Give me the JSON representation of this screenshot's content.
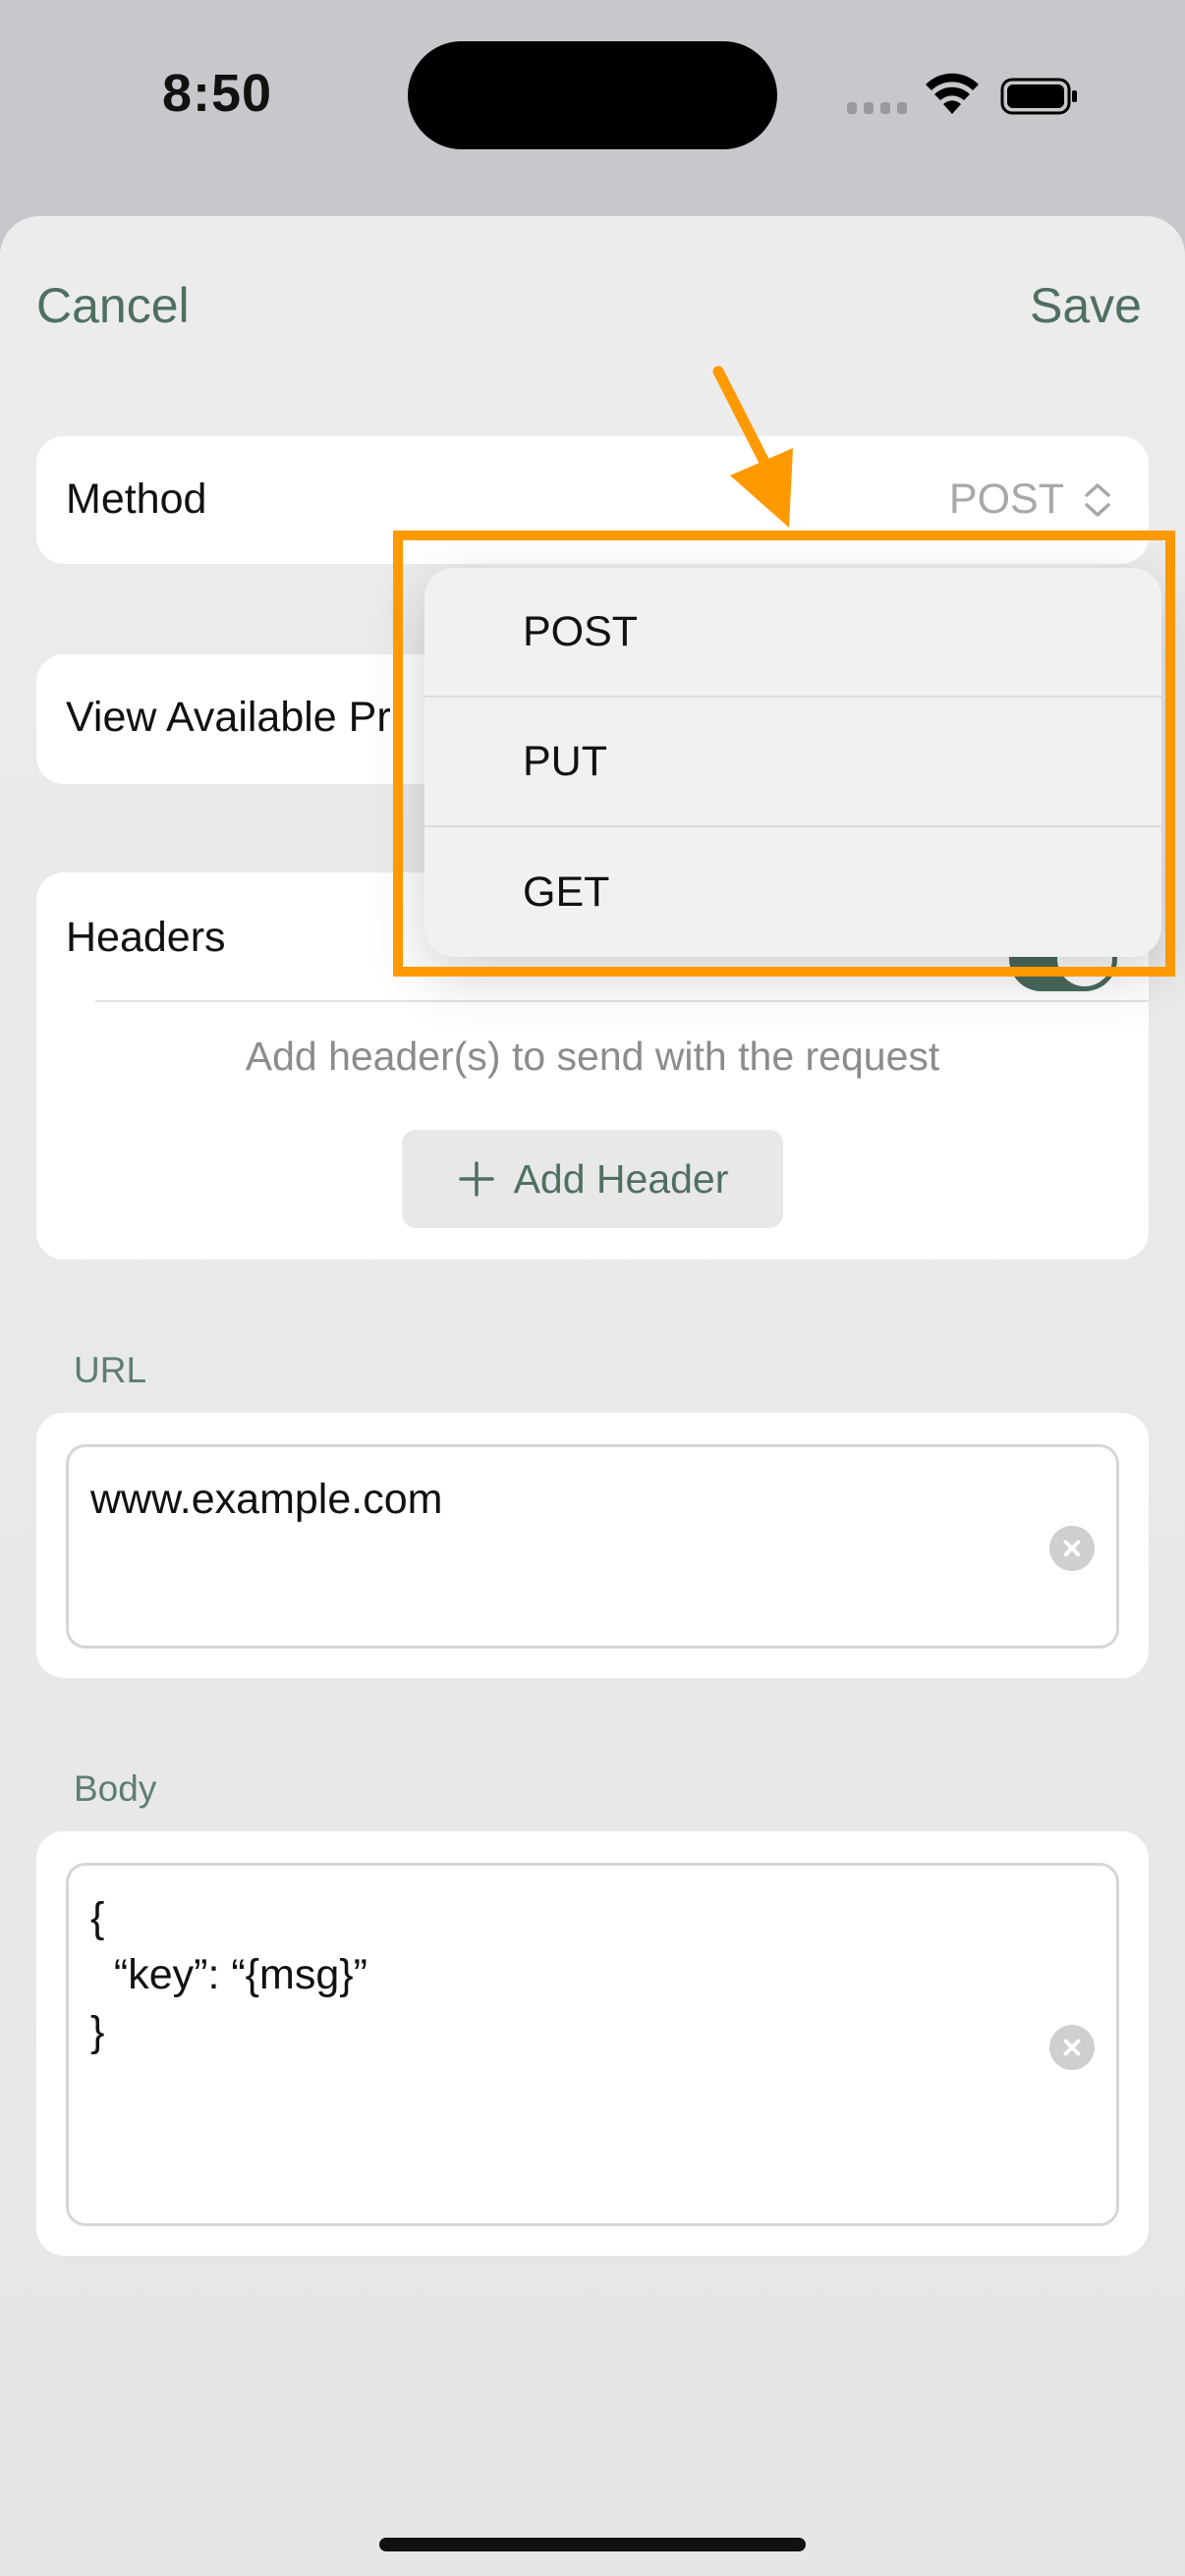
{
  "status_bar": {
    "time": "8:50",
    "icons": [
      "cellular-signal-icon",
      "wifi-icon",
      "battery-icon"
    ]
  },
  "nav": {
    "cancel_label": "Cancel",
    "save_label": "Save"
  },
  "method": {
    "label": "Method",
    "value": "POST",
    "icon": "chevron-updown-icon"
  },
  "available": {
    "label": "View Available Pr"
  },
  "headers": {
    "label": "Headers",
    "toggle_on": true,
    "hint": "Add header(s) to send with the request",
    "add_button": "Add Header",
    "add_icon": "plus-icon"
  },
  "url": {
    "section_label": "URL",
    "value": "www.example.com"
  },
  "body": {
    "section_label": "Body",
    "value": "{\n  “key”: “{msg}”\n}"
  },
  "method_menu": {
    "options": [
      "POST",
      "PUT",
      "GET"
    ]
  },
  "annotation": {
    "highlight_color": "#ff9900"
  },
  "colors": {
    "accent": "#4f7060",
    "toggle": "#4a6b5c"
  }
}
